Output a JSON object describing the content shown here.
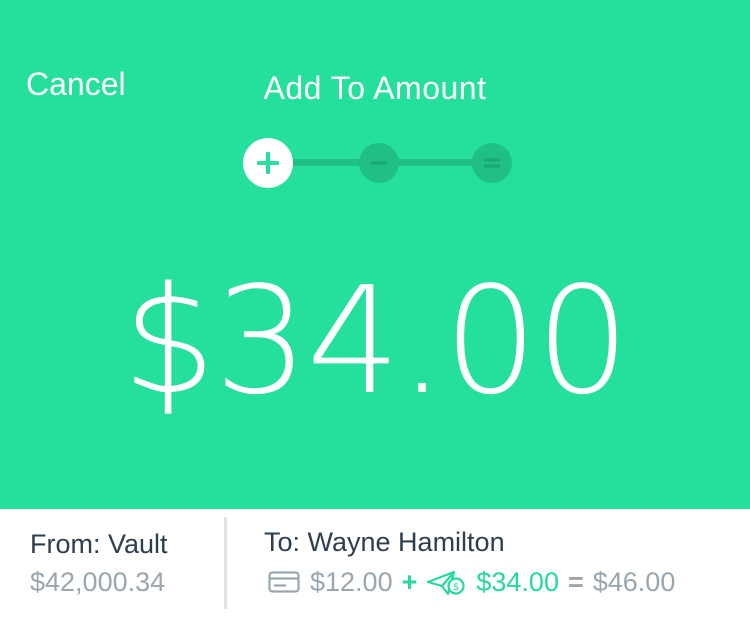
{
  "header": {
    "cancel_label": "Cancel",
    "title": "Add To Amount"
  },
  "steps": {
    "items": [
      {
        "symbol": "+",
        "state": "active"
      },
      {
        "symbol": "−",
        "state": "inactive"
      },
      {
        "symbol": "=",
        "state": "inactive"
      }
    ]
  },
  "amount": {
    "display": "$34.00"
  },
  "transfer": {
    "from_label": "From: Vault",
    "from_balance": "$42,000.34",
    "to_label": "To: Wayne Hamilton",
    "base_amount": "$12.00",
    "plus_sign": "+",
    "added_amount": "$34.00",
    "equals_sign": "=",
    "total_amount": "$46.00"
  },
  "colors": {
    "accent": "#24e09c",
    "accent_dark": "#1fbf85",
    "text_dark": "#2d3e4f",
    "text_muted": "#9aa6ae"
  },
  "icons": {
    "card": "credit-card-icon",
    "money": "money-send-icon"
  }
}
